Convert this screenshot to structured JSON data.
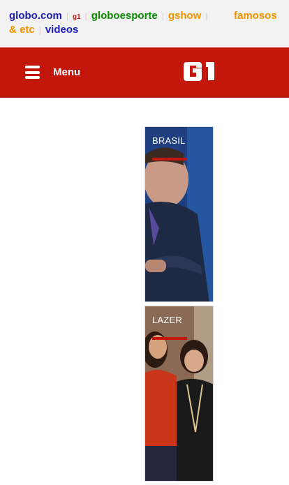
{
  "globo_bar": {
    "links": [
      {
        "label": "globo.com",
        "color": "#1c1cb8"
      },
      {
        "label": "g1",
        "color": "#c4170c"
      },
      {
        "label": "globoesporte",
        "color": "#0a8a00"
      },
      {
        "label": "gshow",
        "color": "#f39200"
      },
      {
        "label": "famosos & etc",
        "color": "#f39200"
      },
      {
        "label": "videos",
        "color": "#1c1cb8"
      }
    ]
  },
  "header": {
    "menu_label": "Menu",
    "logo_text": "G1",
    "bg_color": "#c4170c"
  },
  "cards": [
    {
      "section": "BRASIL",
      "image": "photo of man in dark suit with arms crossed"
    },
    {
      "section": "LAZER",
      "image": "photo of two women smiling"
    }
  ]
}
